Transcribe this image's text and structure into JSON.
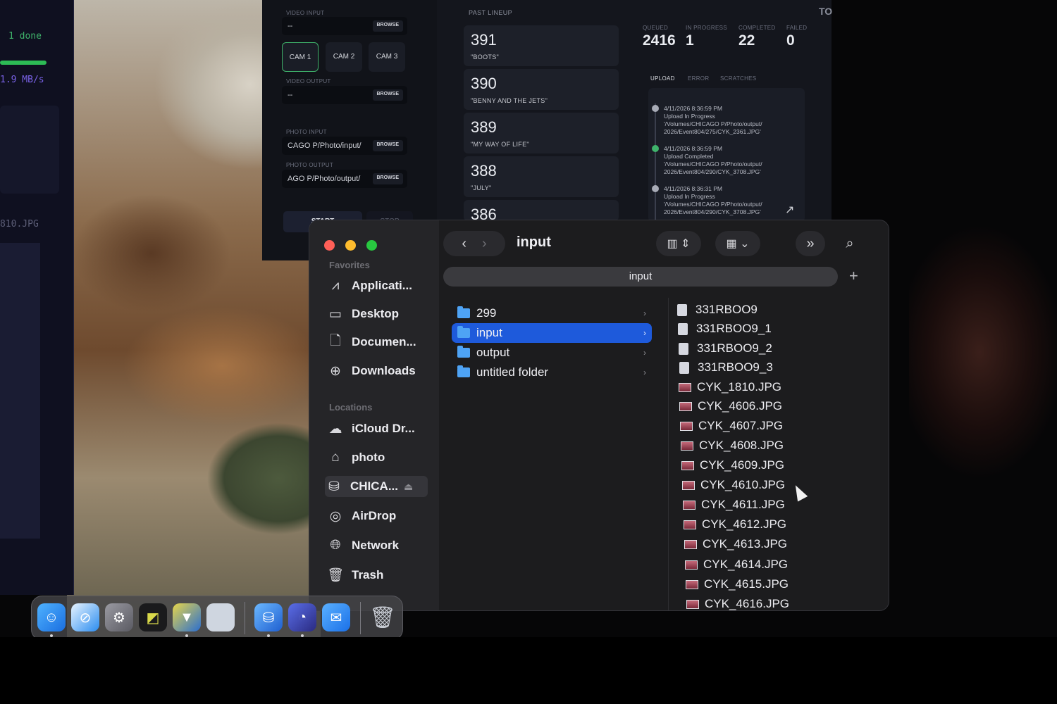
{
  "terminal": {
    "done_text": "1 done",
    "speed_text": "1.9 MB/s",
    "file_text": "810.JPG"
  },
  "dashboard": {
    "video_input_label": "VIDEO INPUT",
    "video_input_value": "--",
    "video_output_label": "VIDEO OUTPUT",
    "video_output_value": "--",
    "photo_input_label": "PHOTO INPUT",
    "photo_input_value": "CAGO P/Photo/input/",
    "photo_output_label": "PHOTO OUTPUT",
    "photo_output_value": "AGO P/Photo/output/",
    "browse_label": "BROWSE",
    "cams": [
      "CAM 1",
      "CAM 2",
      "CAM 3"
    ],
    "start_label": "START",
    "stop_label": "STOP",
    "lineup_title": "PAST LINEUP",
    "lineup": [
      {
        "num": "391",
        "name": "\"BOOTS\""
      },
      {
        "num": "390",
        "name": "\"BENNY AND THE JETS\""
      },
      {
        "num": "389",
        "name": "\"MY WAY OF LIFE\""
      },
      {
        "num": "388",
        "name": "\"JULY\""
      },
      {
        "num": "386",
        "name": ""
      }
    ],
    "stats": [
      {
        "label": "QUEUED",
        "value": "2416"
      },
      {
        "label": "IN PROGRESS",
        "value": "1"
      },
      {
        "label": "COMPLETED",
        "value": "22"
      },
      {
        "label": "FAILED",
        "value": "0"
      }
    ],
    "log_tabs": [
      "UPLOAD",
      "ERROR",
      "SCRATCHES"
    ],
    "log_entries": [
      {
        "time": "4/11/2026 8:36:59 PM",
        "status": "Upload In Progress",
        "path1": "'/Volumes/CHICAGO P/Photo/output/",
        "path2": "2026/Event804/275/CYK_2361.JPG'"
      },
      {
        "time": "4/11/2026 8:36:59 PM",
        "status": "Upload Completed",
        "path1": "'/Volumes/CHICAGO P/Photo/output/",
        "path2": "2026/Event804/290/CYK_3708.JPG'"
      },
      {
        "time": "4/11/2026 8:36:31 PM",
        "status": "Upload In Progress",
        "path1": "'/Volumes/CHICAGO P/Photo/output/",
        "path2": "2026/Event804/290/CYK_3708.JPG'"
      }
    ],
    "corner_text": "TO"
  },
  "finder": {
    "title": "input",
    "path_bar": "input",
    "favorites_label": "Favorites",
    "locations_label": "Locations",
    "favorites": [
      "Applicati...",
      "Desktop",
      "Documen...",
      "Downloads"
    ],
    "locations": [
      "iCloud Dr...",
      "photo",
      "CHICA...",
      "AirDrop",
      "Network",
      "Trash"
    ],
    "folders": [
      "299",
      "input",
      "output",
      "untitled folder"
    ],
    "files": [
      "331RBOO9",
      "331RBOO9_1",
      "331RBOO9_2",
      "331RBOO9_3",
      "CYK_1810.JPG",
      "CYK_4606.JPG",
      "CYK_4607.JPG",
      "CYK_4608.JPG",
      "CYK_4609.JPG",
      "CYK_4610.JPG",
      "CYK_4611.JPG",
      "CYK_4612.JPG",
      "CYK_4613.JPG",
      "CYK_4614.JPG",
      "CYK_4615.JPG",
      "CYK_4616.JPG"
    ]
  },
  "colors": {
    "accent_selection": "#1e5adb",
    "folder_blue": "#4ea3f5",
    "success_green": "#3fb36b"
  }
}
